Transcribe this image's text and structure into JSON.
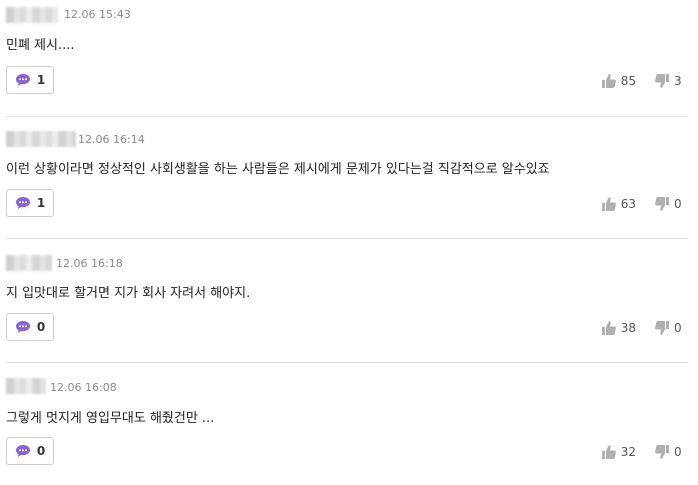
{
  "comments": [
    {
      "time": "12.06 15:43",
      "text": "민폐 제시....",
      "replies": "1",
      "likes": "85",
      "dislikes": "3"
    },
    {
      "time": "12.06 16:14",
      "text": "이런 상황이라면 정상적인 사회생활을 하는 사람들은 제시에게 문제가 있다는걸 직감적으로 알수있죠",
      "replies": "1",
      "likes": "63",
      "dislikes": "0"
    },
    {
      "time": "12.06 16:18",
      "text": "지 입맛대로 할거면 지가 회사 자려서 해야지.",
      "replies": "0",
      "likes": "38",
      "dislikes": "0"
    },
    {
      "time": "12.06 16:08",
      "text": "그렇게 멋지게 영입무대도 해줬건만 ...",
      "replies": "0",
      "likes": "32",
      "dislikes": "0"
    }
  ],
  "colors": {
    "accent": "#8a63d2",
    "icon_gray": "#b0b0b0",
    "separator": "#e2e2e2"
  },
  "icons": {
    "reply": "speech-bubble-icon",
    "like": "thumbs-up-icon",
    "dislike": "thumbs-down-icon"
  }
}
